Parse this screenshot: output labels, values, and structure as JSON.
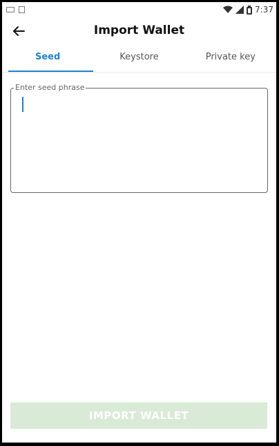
{
  "status_bar": {
    "time": "7:37",
    "icons": [
      "keyboard-icon",
      "sd-card-icon",
      "wifi-icon",
      "signal-icon",
      "battery-icon"
    ]
  },
  "app_bar": {
    "title": "Import Wallet",
    "back_icon": "arrow-left-icon"
  },
  "tabs": [
    {
      "label": "Seed",
      "active": true
    },
    {
      "label": "Keystore",
      "active": false
    },
    {
      "label": "Private key",
      "active": false
    }
  ],
  "seed_input": {
    "label": "Enter seed phrase",
    "value": ""
  },
  "import_button": {
    "label": "IMPORT WALLET",
    "enabled": false
  },
  "colors": {
    "accent": "#1e83d1",
    "button_disabled": "#d9ebd6"
  }
}
